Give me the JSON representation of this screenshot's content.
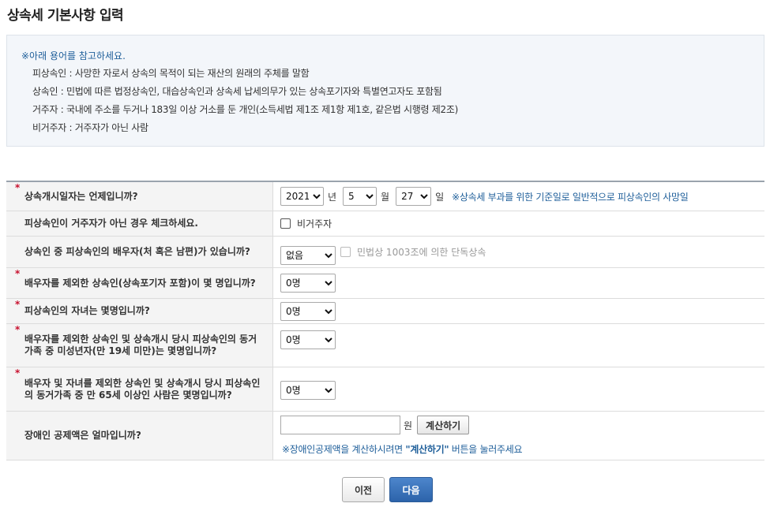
{
  "page_title": "상속세 기본사항 입력",
  "notice": {
    "head": "※아래 용어를 참고하세요.",
    "lines": [
      "피상속인 : 사망한 자로서 상속의 목적이 되는 재산의 원래의 주체를 말함",
      "상속인 : 민법에 따른 법정상속인, 대습상속인과 상속세 납세의무가 있는 상속포기자와 특별연고자도 포함됨",
      "거주자 : 국내에 주소를 두거나 183일 이상 거소를 둔 개인(소득세법 제1조 제1항 제1호, 같은법 시행령 제2조)",
      "비거주자 : 거주자가 아닌 사람"
    ]
  },
  "required_mark": "*",
  "form": {
    "date": {
      "label": "상속개시일자는 언제입니까?",
      "year": "2021",
      "year_unit": "년",
      "month": "5",
      "month_unit": "월",
      "day": "27",
      "day_unit": "일",
      "hint": "※상속세 부과를 위한 기준일로 일반적으로 피상속인의 사망일"
    },
    "nonresident": {
      "label": "피상속인이 거주자가 아닌 경우 체크하세요.",
      "checkbox_label": "비거주자"
    },
    "spouse": {
      "label": "상속인 중 피상속인의 배우자(처 혹은 남편)가 있습니까?",
      "value": "없음",
      "checkbox_label": "민법상 1003조에 의한 단독상속"
    },
    "heirs_count": {
      "label": "배우자를 제외한 상속인(상속포기자 포함)이 몇 명입니까?",
      "value": "0명"
    },
    "children_count": {
      "label": "피상속인의 자녀는 몇명입니까?",
      "value": "0명"
    },
    "minors_count": {
      "label": "배우자를 제외한 상속인 및 상속개시 당시 피상속인의 동거가족 중 미성년자(만 19세 미만)는 몇명입니까?",
      "value": "0명"
    },
    "elderly_count": {
      "label": "배우자 및 자녀를 제외한 상속인 및 상속개시 당시 피상속인의 동거가족 중 만 65세 이상인 사람은 몇명입니까?",
      "value": "0명"
    },
    "disabled_deduction": {
      "label": "장애인 공제액은 얼마입니까?",
      "value": "",
      "unit": "원",
      "calc_button": "계산하기",
      "hint_prefix": "※장애인공제액을 계산하시려면 ",
      "hint_button": "\"계산하기\"",
      "hint_suffix": " 버튼을 눌러주세요"
    }
  },
  "buttons": {
    "prev": "이전",
    "next": "다음"
  }
}
